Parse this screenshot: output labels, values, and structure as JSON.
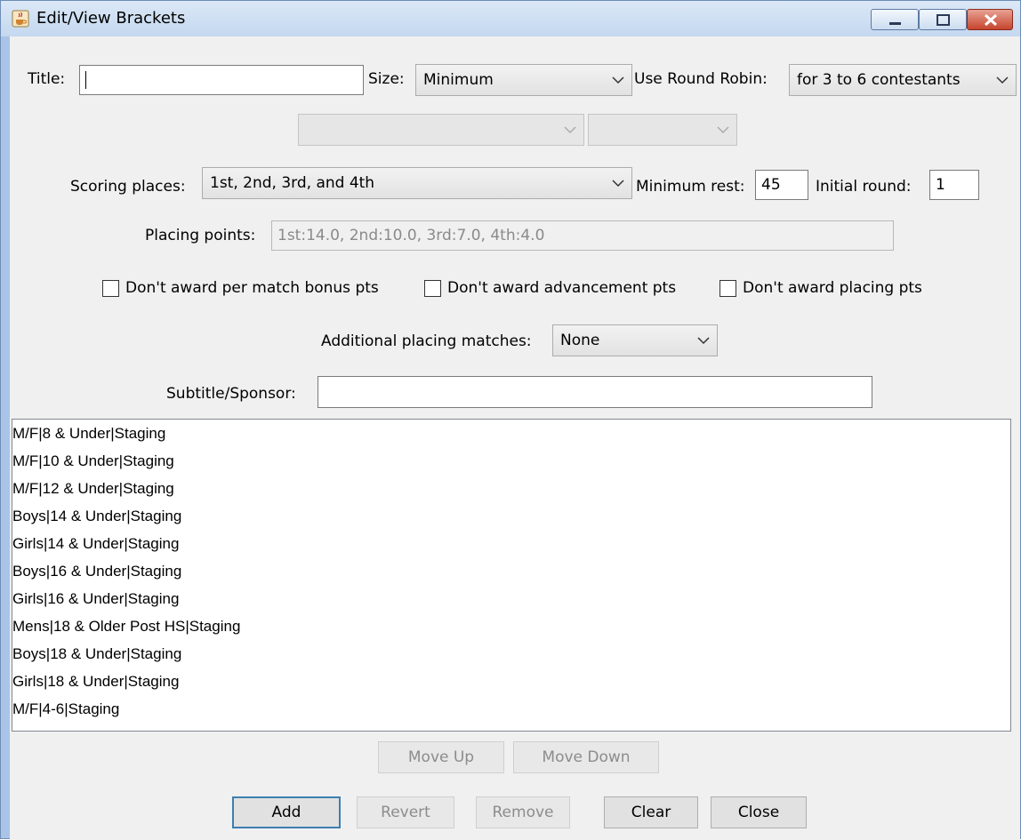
{
  "window": {
    "title": "Edit/View Brackets"
  },
  "form": {
    "title_label": "Title:",
    "title_value": "",
    "size_label": "Size:",
    "size_value": "Minimum",
    "round_robin_label": "Use Round Robin:",
    "round_robin_value": "for 3 to 6 contestants",
    "extra_combo_1_value": "",
    "extra_combo_2_value": "",
    "scoring_places_label": "Scoring places:",
    "scoring_places_value": "1st, 2nd, 3rd, and 4th",
    "minimum_rest_label": "Minimum rest:",
    "minimum_rest_value": "45",
    "initial_round_label": "Initial round:",
    "initial_round_value": "1",
    "placing_points_label": "Placing points:",
    "placing_points_value": "1st:14.0, 2nd:10.0, 3rd:7.0, 4th:4.0",
    "checkbox_bonus_label": "Don't award per match bonus pts",
    "checkbox_bonus_checked": false,
    "checkbox_advancement_label": "Don't award advancement pts",
    "checkbox_advancement_checked": false,
    "checkbox_placing_label": "Don't award placing pts",
    "checkbox_placing_checked": false,
    "additional_matches_label": "Additional placing matches:",
    "additional_matches_value": "None",
    "subtitle_label": "Subtitle/Sponsor:",
    "subtitle_value": ""
  },
  "brackets": [
    "M/F|8 & Under|Staging",
    "M/F|10 & Under|Staging",
    "M/F|12 & Under|Staging",
    "Boys|14 & Under|Staging",
    "Girls|14 & Under|Staging",
    "Boys|16 & Under|Staging",
    "Girls|16 & Under|Staging",
    "Mens|18 & Older Post HS|Staging",
    "Boys|18 & Under|Staging",
    "Girls|18 & Under|Staging",
    "M/F|4-6|Staging"
  ],
  "buttons": {
    "move_up": "Move Up",
    "move_down": "Move Down",
    "add": "Add",
    "revert": "Revert",
    "remove": "Remove",
    "clear": "Clear",
    "close": "Close"
  },
  "colors": {
    "window_frame": "#a9c4e6",
    "dialog_background": "#f0f0f0",
    "close_button": "#c7442d",
    "default_button_border": "#3c7fb1"
  },
  "icons": {
    "app": "java-cup-icon",
    "minimize": "minimize-icon",
    "maximize": "maximize-icon",
    "close": "close-icon",
    "dropdown": "chevron-down-icon"
  }
}
